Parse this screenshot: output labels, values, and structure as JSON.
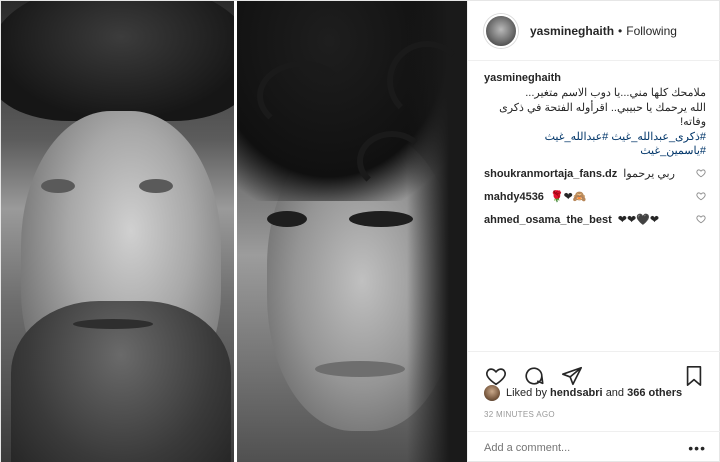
{
  "header": {
    "username": "yasmineghaith",
    "separator": "•",
    "follow_status": "Following"
  },
  "caption": {
    "username": "yasmineghaith",
    "line1": "ملامحك كلها مني...يا دوب الاسم متغير...",
    "line2": "الله يرحمك يا حبيبي.. اقرأوله الفتحة في ذكرى وفاته!",
    "hashtags": "#ذكرى_عبدالله_غيث #عبدالله_غيث #ياسمين_غيث"
  },
  "comments": [
    {
      "user": "shoukranmortaja_fans.dz",
      "text": "ربي يرحموا"
    },
    {
      "user": "mahdy4536",
      "text": "🌹❤🙈"
    },
    {
      "user": "ahmed_osama_the_best",
      "text": "❤❤🖤❤"
    }
  ],
  "likes": {
    "prefix": "Liked by",
    "user": "hendsabri",
    "and": "and",
    "others": "366 others"
  },
  "timestamp": "32 MINUTES AGO",
  "add_comment": {
    "placeholder": "Add a comment...",
    "more": "•••"
  },
  "icons": {
    "like": "heart-icon",
    "comment": "comment-icon",
    "share": "share-icon",
    "save": "bookmark-icon"
  }
}
